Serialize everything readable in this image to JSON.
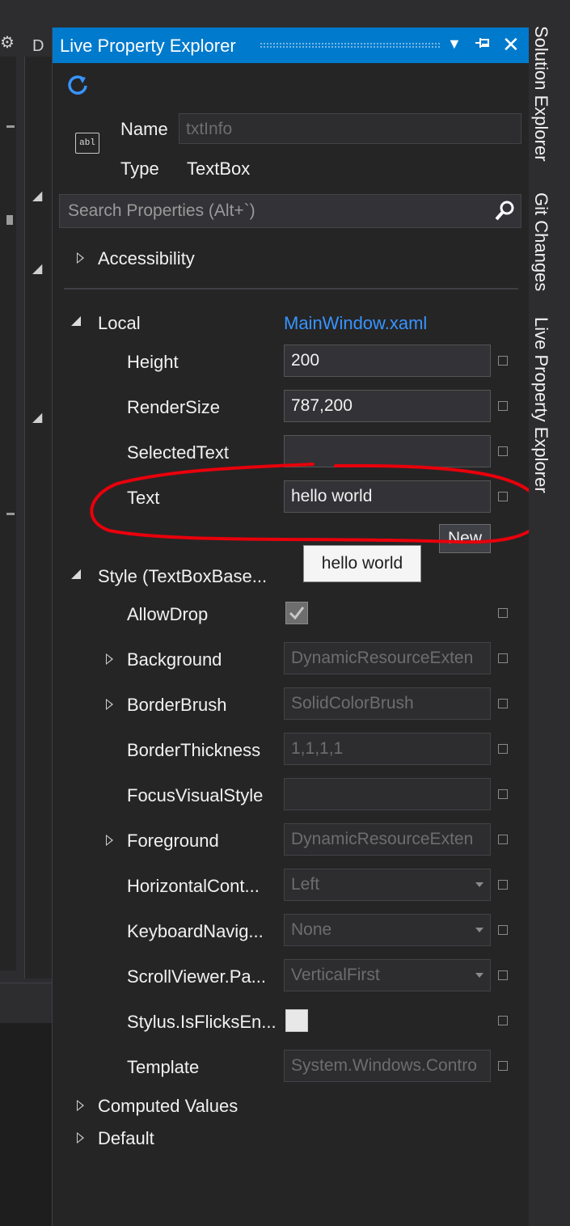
{
  "left_partial": {
    "d_char": "D"
  },
  "panel": {
    "title": "Live Property Explorer",
    "element": {
      "name_label": "Name",
      "name_value": "txtInfo",
      "type_label": "Type",
      "type_value": "TextBox",
      "type_icon_text": "abl"
    },
    "search": {
      "placeholder": "Search Properties (Alt+`)"
    },
    "sections": {
      "accessibility": "Accessibility",
      "local": "Local",
      "local_source": "MainWindow.xaml",
      "style": "Style (TextBoxBase...",
      "computed": "Computed Values",
      "default": "Default"
    },
    "local_props": [
      {
        "name": "Height",
        "value": "200"
      },
      {
        "name": "RenderSize",
        "value": "787,200"
      },
      {
        "name": "SelectedText",
        "value": ""
      },
      {
        "name": "Text",
        "value": "hello world"
      }
    ],
    "new_button": "New",
    "tooltip": "hello world",
    "style_props": [
      {
        "name": "AllowDrop",
        "value": ""
      },
      {
        "name": "Background",
        "value": "DynamicResourceExten"
      },
      {
        "name": "BorderBrush",
        "value": "SolidColorBrush"
      },
      {
        "name": "BorderThickness",
        "value": "1,1,1,1"
      },
      {
        "name": "FocusVisualStyle",
        "value": ""
      },
      {
        "name": "Foreground",
        "value": "DynamicResourceExten"
      },
      {
        "name": "HorizontalCont...",
        "value": "Left"
      },
      {
        "name": "KeyboardNavig...",
        "value": "None"
      },
      {
        "name": "ScrollViewer.Pa...",
        "value": "VerticalFirst"
      },
      {
        "name": "Stylus.IsFlicksEn...",
        "value": ""
      },
      {
        "name": "Template",
        "value": "System.Windows.Contro"
      }
    ]
  },
  "side_tabs": [
    "Solution Explorer",
    "Git Changes",
    "Live Property Explorer"
  ],
  "colors": {
    "accent": "#007acc",
    "link": "#3794ff",
    "annotation": "#e8000b"
  }
}
